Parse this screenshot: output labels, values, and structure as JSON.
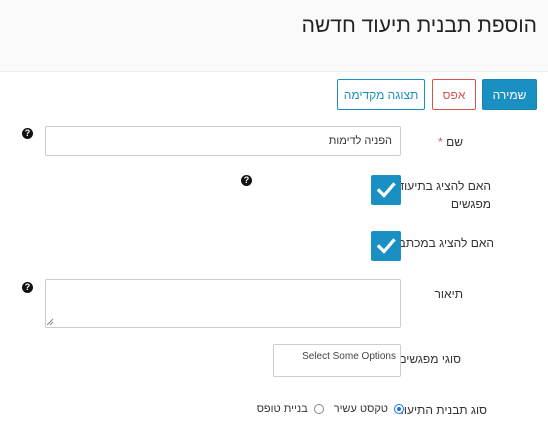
{
  "page": {
    "title": "הוספת תבנית תיעוד חדשה"
  },
  "toolbar": {
    "save_label": "שמירה",
    "reset_label": "אפס",
    "preview_label": "תצוגה מקדימה"
  },
  "form": {
    "name": {
      "label": "שם",
      "required_mark": "*",
      "value": "הפניה לדימות"
    },
    "show_in_meetings": {
      "label": "האם להציג בתיעוד מפגשים",
      "checked": true
    },
    "show_in_letters": {
      "label": "האם להציג במכתבים",
      "checked": true
    },
    "description": {
      "label": "תיאור",
      "value": ""
    },
    "meeting_types": {
      "label": "סוגי מפגשים",
      "placeholder": "Select Some Options"
    },
    "template_type": {
      "label": "סוג תבנית התיעוד",
      "options": [
        {
          "label": "טקסט עשיר",
          "selected": true
        },
        {
          "label": "בניית טופס",
          "selected": false
        }
      ]
    }
  },
  "icons": {
    "help": "question-circle-icon",
    "checkbox": "checkmark-icon",
    "help_glyph": "?"
  },
  "colors": {
    "primary": "#1a8fc1",
    "danger": "#d9534f",
    "radio_selected": "#1a73e8"
  }
}
